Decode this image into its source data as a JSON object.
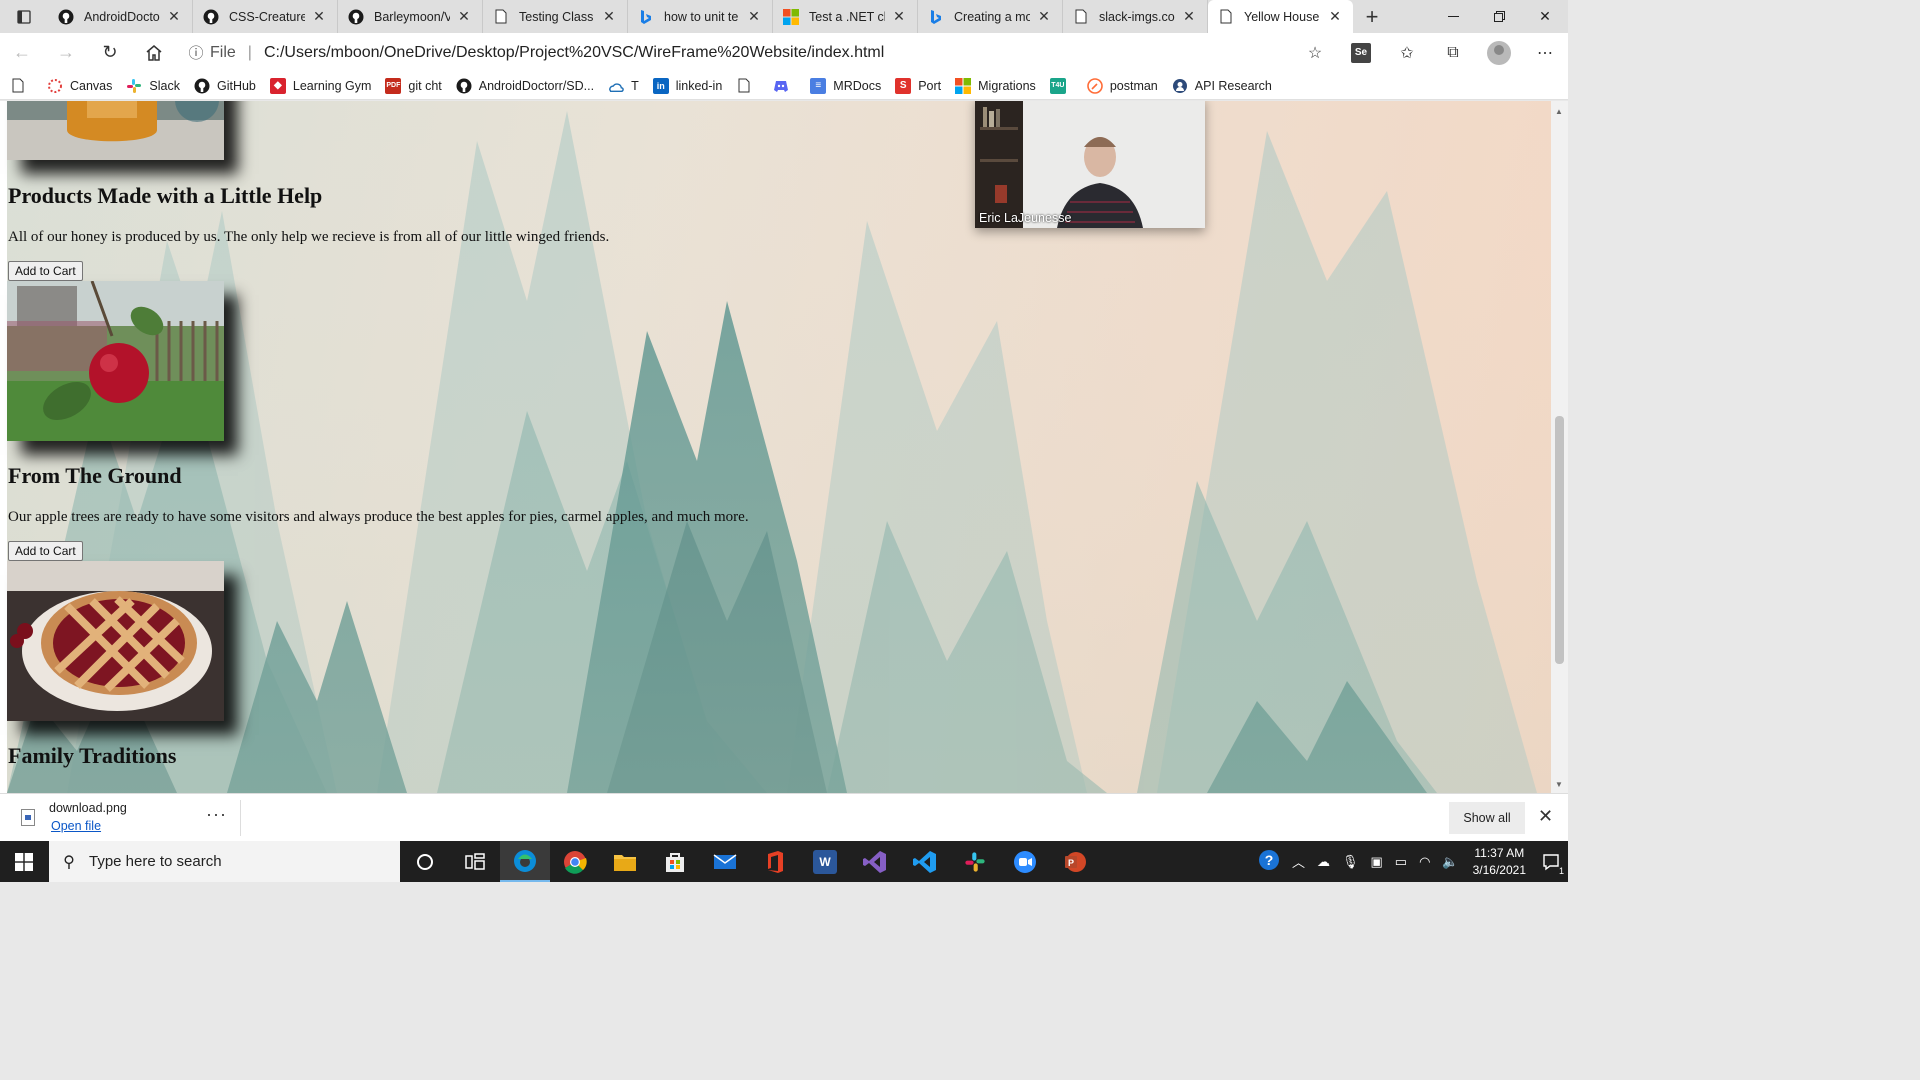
{
  "browser": {
    "tabs": [
      {
        "label": "AndroidDocto",
        "icon": "github-icon"
      },
      {
        "label": "CSS-Creature/",
        "icon": "github-icon"
      },
      {
        "label": "Barleymoon/V",
        "icon": "github-icon"
      },
      {
        "label": "Testing Class L",
        "icon": "page-icon"
      },
      {
        "label": "how to unit te",
        "icon": "bing-icon"
      },
      {
        "label": "Test a .NET cla",
        "icon": "microsoft-icon"
      },
      {
        "label": "Creating a mo",
        "icon": "bing-icon"
      },
      {
        "label": "slack-imgs.cor",
        "icon": "page-icon"
      },
      {
        "label": "Yellow House",
        "icon": "page-icon",
        "active": true
      }
    ],
    "address": {
      "scheme": "File",
      "url": "C:/Users/mboon/OneDrive/Desktop/Project%20VSC/WireFrame%20Website/index.html"
    },
    "favorites": [
      {
        "label": "",
        "icon": "page-icon"
      },
      {
        "label": "Canvas",
        "icon": "canvas-icon"
      },
      {
        "label": "Slack",
        "icon": "slack-icon"
      },
      {
        "label": "GitHub",
        "icon": "github-icon"
      },
      {
        "label": "Learning Gym",
        "icon": "learning-gym-icon"
      },
      {
        "label": "git cht",
        "icon": "pdf-icon"
      },
      {
        "label": "AndroidDoctorr/SD...",
        "icon": "github-icon"
      },
      {
        "label": "T",
        "icon": "cloud-icon"
      },
      {
        "label": "linked-in",
        "icon": "linkedin-icon"
      },
      {
        "label": "",
        "icon": "page-icon"
      },
      {
        "label": "",
        "icon": "discord-icon"
      },
      {
        "label": "MRDocs",
        "icon": "docs-icon"
      },
      {
        "label": "Port",
        "icon": "s-icon"
      },
      {
        "label": "Migrations",
        "icon": "microsoft-icon"
      },
      {
        "label": "",
        "icon": "t4u-icon"
      },
      {
        "label": "postman",
        "icon": "postman-icon"
      },
      {
        "label": "API Research",
        "icon": "api-icon"
      }
    ]
  },
  "page": {
    "products": [
      {
        "title": "Products Made with a Little Help",
        "description": "All of our honey is produced by us. The only help we recieve is from all of our little winged friends.",
        "button": "Add to Cart",
        "image": "honey-jar"
      },
      {
        "title": "From The Ground",
        "description": "Our apple trees are ready to have some visitors and always produce the best apples for pies, carmel apples, and much more.",
        "button": "Add to Cart",
        "image": "apple-on-tree"
      },
      {
        "title": "Family Traditions",
        "description": "",
        "button": "",
        "image": "cherry-pie"
      }
    ],
    "video_overlay": {
      "participant": "Eric LaJeunesse"
    }
  },
  "download": {
    "filename": "download.png",
    "open_label": "Open file",
    "show_all": "Show all"
  },
  "taskbar": {
    "search_placeholder": "Type here to search",
    "apps": [
      "cortana",
      "task-view",
      "edge",
      "chrome",
      "file-explorer",
      "store",
      "mail",
      "office",
      "word",
      "visual-studio",
      "vscode",
      "slack",
      "zoom",
      "powerpoint"
    ],
    "time": "11:37 AM",
    "date": "3/16/2021",
    "notifications": "1"
  },
  "colors": {
    "accent": "#0b57c7",
    "page_peach": "#f3d8c5",
    "tree_teal": "#4d8f8a"
  }
}
